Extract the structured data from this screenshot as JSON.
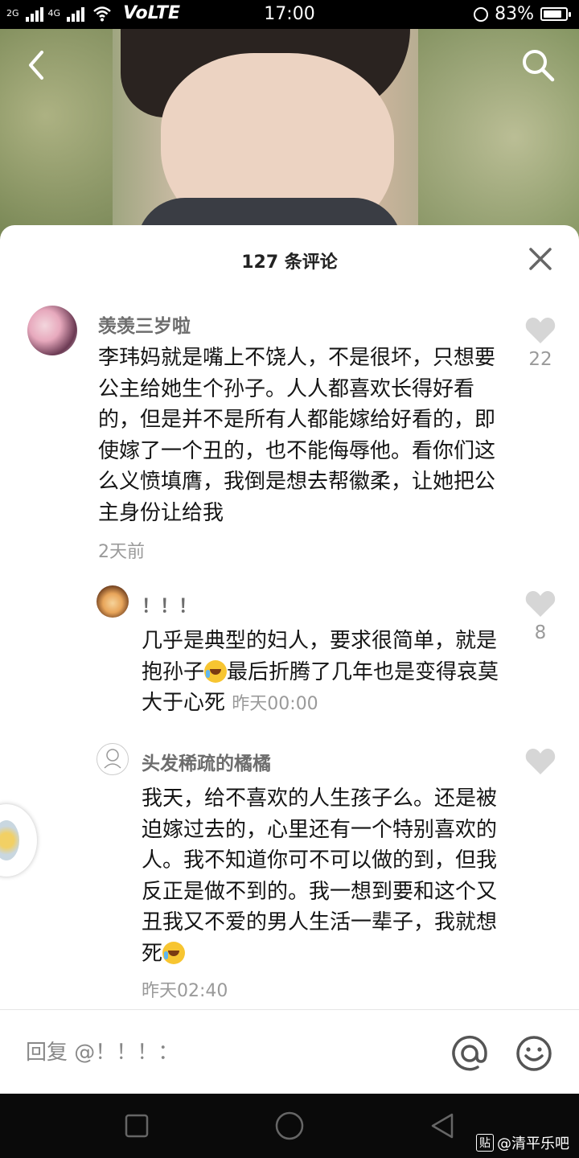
{
  "status_bar": {
    "network_left": "2G",
    "network_right": "4G",
    "carrier": "VoLTE",
    "time": "17:00",
    "battery": "83%",
    "battery_level": 0.83
  },
  "header": {
    "back_icon": "chevron-left-icon",
    "search_icon": "search-icon"
  },
  "comments_panel": {
    "title": "127 条评论",
    "close_icon": "close-icon",
    "comments": [
      {
        "user": "羡羡三岁啦",
        "text": "李玮妈就是嘴上不饶人，不是很坏，只想要公主给她生个孙子。人人都喜欢长得好看的，但是并不是所有人都能嫁给好看的，即使嫁了一个丑的，也不能侮辱他。看你们这么义愤填膺，我倒是想去帮徽柔，让她把公主身份让给我",
        "time": "2天前",
        "likes": "22"
      },
      {
        "user": "！！！",
        "text_a": "几乎是典型的妇人，要求很简单，就是抱孙子",
        "text_b": "最后折腾了几年也是变得哀莫大于心死",
        "time": "昨天00:00",
        "likes": "8"
      },
      {
        "user": "头发稀疏的橘橘",
        "text_a": "我天，给不喜欢的人生孩子么。还是被迫嫁过去的，心里还有一个特别喜欢的人。我不知道你可不可以做的到，但我反正是做不到的。我一想到要和这个又丑我又不爱的男人生活一辈子，我就想死",
        "time": "昨天02:40"
      }
    ]
  },
  "reply_bar": {
    "placeholder": "回复 @！！！：",
    "at_icon": "at-icon",
    "emoji_icon": "smile-icon"
  },
  "watermark": {
    "badge": "贴",
    "text": "@清平乐吧"
  }
}
